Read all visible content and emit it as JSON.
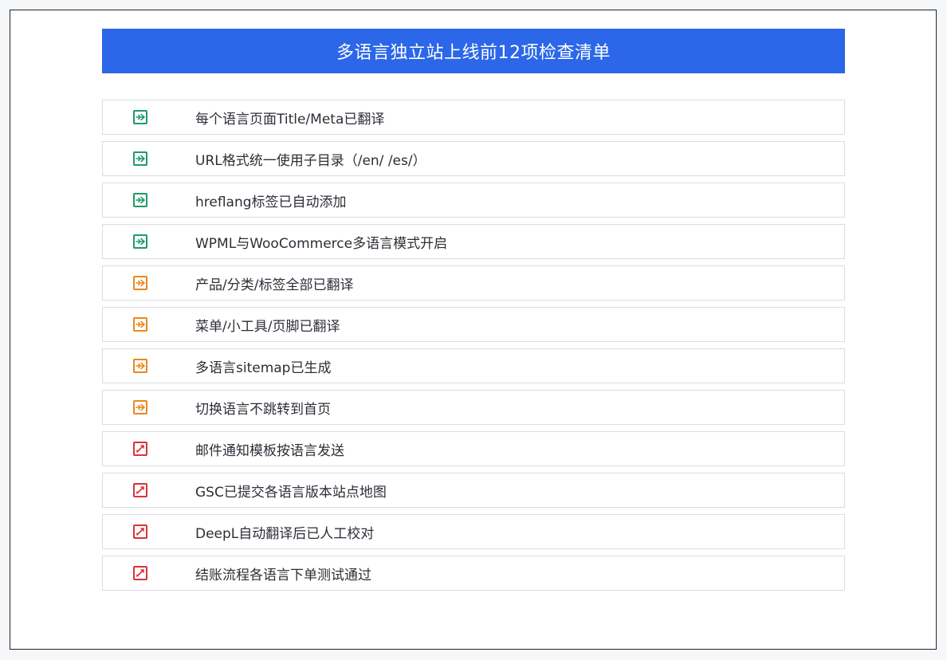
{
  "header": {
    "title": "多语言独立站上线前12项检查清单"
  },
  "colors": {
    "green": "#1e9a6a",
    "orange": "#e8891d",
    "red": "#d9343a",
    "header_bg": "#2b67e8"
  },
  "items": [
    {
      "label": "每个语言页面Title/Meta已翻译",
      "status": "green",
      "icon": "plane-icon"
    },
    {
      "label": "URL格式统一使用子目录（/en/ /es/）",
      "status": "green",
      "icon": "plane-icon"
    },
    {
      "label": "hreflang标签已自动添加",
      "status": "green",
      "icon": "plane-icon"
    },
    {
      "label": "WPML与WooCommerce多语言模式开启",
      "status": "green",
      "icon": "plane-icon"
    },
    {
      "label": "产品/分类/标签全部已翻译",
      "status": "orange",
      "icon": "plane-icon"
    },
    {
      "label": "菜单/小工具/页脚已翻译",
      "status": "orange",
      "icon": "plane-icon"
    },
    {
      "label": "多语言sitemap已生成",
      "status": "orange",
      "icon": "plane-icon"
    },
    {
      "label": "切换语言不跳转到首页",
      "status": "orange",
      "icon": "plane-icon"
    },
    {
      "label": "邮件通知模板按语言发送",
      "status": "red",
      "icon": "edit-icon"
    },
    {
      "label": "GSC已提交各语言版本站点地图",
      "status": "red",
      "icon": "edit-icon"
    },
    {
      "label": "DeepL自动翻译后已人工校对",
      "status": "red",
      "icon": "edit-icon"
    },
    {
      "label": "结账流程各语言下单测试通过",
      "status": "red",
      "icon": "edit-icon"
    }
  ]
}
